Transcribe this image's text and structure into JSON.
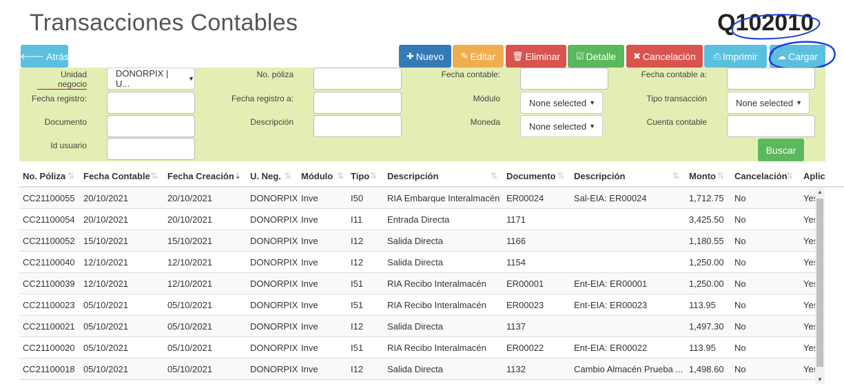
{
  "header": {
    "title": "Transacciones Contables",
    "code": "Q102010"
  },
  "toolbar": {
    "back": "Atrás",
    "new": "Nuevo",
    "edit": "Editar",
    "delete": "Eliminar",
    "detail": "Detalle",
    "cancel": "Cancelación",
    "print": "Imprimir",
    "upload": "Cargar"
  },
  "filters": {
    "unidad_negocio_label": "Unidad negocio",
    "unidad_negocio_value": "DONORPIX | U...",
    "no_poliza_label": "No. póliza",
    "fecha_contable_label": "Fecha contable:",
    "fecha_contable_a_label": "Fecha contable a:",
    "fecha_registro_label": "Fecha registro:",
    "fecha_registro_a_label": "Fecha registro a:",
    "modulo_label": "Módulo",
    "modulo_value": "None selected",
    "tipo_transaccion_label": "Tipo transacción",
    "tipo_transaccion_value": "None selected",
    "documento_label": "Documento",
    "descripcion_label": "Descripción",
    "moneda_label": "Moneda",
    "moneda_value": "None selected",
    "cuenta_contable_label": "Cuenta contable",
    "id_usuario_label": "Id usuario",
    "search": "Buscar"
  },
  "table": {
    "headers": [
      "No. Póliza",
      "Fecha Contable",
      "Fecha Creación",
      "U. Neg.",
      "Módulo",
      "Tipo",
      "Descripción",
      "Documento",
      "Descripción",
      "Monto",
      "Cancelación",
      "Aplic"
    ],
    "rows": [
      [
        "CC21100055",
        "20/10/2021",
        "20/10/2021",
        "DONORPIX",
        "Inve",
        "I50",
        "RIA Embarque Interalmacén",
        "ER00024",
        "Sal-EIA: ER00024",
        "1,712.75",
        "No",
        "Yes"
      ],
      [
        "CC21100054",
        "20/10/2021",
        "20/10/2021",
        "DONORPIX",
        "Inve",
        "I11",
        "Entrada Directa",
        "1171",
        "",
        "3,425.50",
        "No",
        "Yes"
      ],
      [
        "CC21100052",
        "15/10/2021",
        "15/10/2021",
        "DONORPIX",
        "Inve",
        "I12",
        "Salida Directa",
        "1166",
        "",
        "1,180.55",
        "No",
        "Yes"
      ],
      [
        "CC21100040",
        "12/10/2021",
        "12/10/2021",
        "DONORPIX",
        "Inve",
        "I12",
        "Salida Directa",
        "1154",
        "",
        "1,250.00",
        "No",
        "Yes"
      ],
      [
        "CC21100039",
        "12/10/2021",
        "12/10/2021",
        "DONORPIX",
        "Inve",
        "I51",
        "RIA Recibo Interalmacén",
        "ER00001",
        "Ent-EIA: ER00001",
        "1,250.00",
        "No",
        "Yes"
      ],
      [
        "CC21100023",
        "05/10/2021",
        "05/10/2021",
        "DONORPIX",
        "Inve",
        "I51",
        "RIA Recibo Interalmacén",
        "ER00023",
        "Ent-EIA: ER00023",
        "113.95",
        "No",
        "Yes"
      ],
      [
        "CC21100021",
        "05/10/2021",
        "05/10/2021",
        "DONORPIX",
        "Inve",
        "I12",
        "Salida Directa",
        "1137",
        "",
        "1,497.30",
        "No",
        "Yes"
      ],
      [
        "CC21100020",
        "05/10/2021",
        "05/10/2021",
        "DONORPIX",
        "Inve",
        "I51",
        "RIA Recibo Interalmacén",
        "ER00022",
        "Ent-EIA: ER00022",
        "113.95",
        "No",
        "Yes"
      ],
      [
        "CC21100018",
        "05/10/2021",
        "05/10/2021",
        "DONORPIX",
        "Inve",
        "I12",
        "Salida Directa",
        "1132",
        "Cambio Almacén Prueba ...",
        "1,498.60",
        "No",
        "Yes"
      ]
    ]
  }
}
